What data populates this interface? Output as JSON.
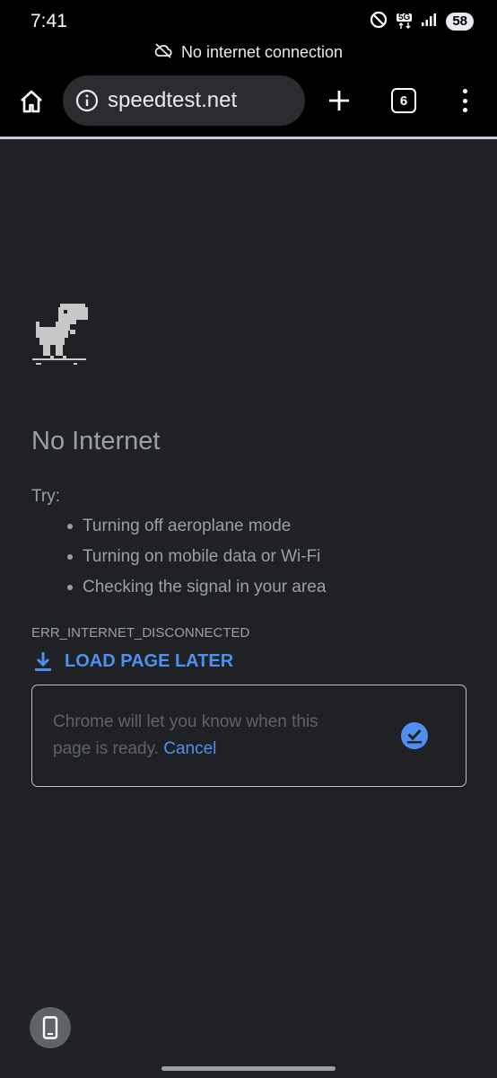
{
  "status_bar": {
    "time": "7:41",
    "network": "5G",
    "battery": "58"
  },
  "offline_banner": {
    "text": "No internet connection"
  },
  "toolbar": {
    "url": "speedtest.net",
    "tab_count": "6"
  },
  "error_page": {
    "title": "No Internet",
    "try_label": "Try:",
    "suggestions": [
      "Turning off aeroplane mode",
      "Turning on mobile data or Wi-Fi",
      "Checking the signal in your area"
    ],
    "error_code": "ERR_INTERNET_DISCONNECTED",
    "load_later_label": "LOAD PAGE LATER",
    "notify_text": "Chrome will let you know when this page is ready.",
    "cancel_label": "Cancel"
  },
  "icons": {
    "status": [
      "do-not-disturb-icon",
      "5g-icon",
      "signal-icon",
      "battery-icon"
    ],
    "banner": "cloud-off-icon",
    "toolbar": [
      "home-icon",
      "info-icon",
      "plus-icon",
      "tab-switcher-icon",
      "more-vert-icon"
    ],
    "page": [
      "dino-icon",
      "download-icon",
      "scheduled-check-icon",
      "phone-icon"
    ]
  },
  "colors": {
    "accent": "#4d90f0",
    "background": "#202124",
    "text_muted": "#9aa0a6"
  }
}
